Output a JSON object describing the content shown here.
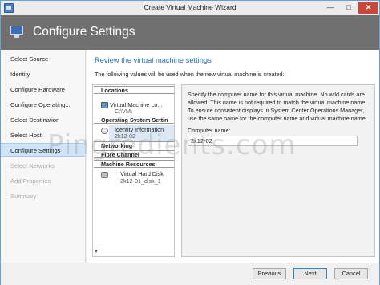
{
  "window": {
    "title": "Create Virtual Machine Wizard"
  },
  "banner": {
    "title": "Configure Settings",
    "icon": "monitor-icon"
  },
  "nav": {
    "items": [
      {
        "label": "Select Source",
        "state": "normal"
      },
      {
        "label": "Identity",
        "state": "normal"
      },
      {
        "label": "Configure Hardware",
        "state": "normal"
      },
      {
        "label": "Configure Operating...",
        "state": "normal"
      },
      {
        "label": "Select Destination",
        "state": "normal"
      },
      {
        "label": "Select Host",
        "state": "normal"
      },
      {
        "label": "Configure Settings",
        "state": "active"
      },
      {
        "label": "Select Networks",
        "state": "disabled"
      },
      {
        "label": "Add Properties",
        "state": "disabled"
      },
      {
        "label": "Summary",
        "state": "disabled"
      }
    ]
  },
  "content": {
    "heading": "Review the virtual machine settings",
    "intro": "The following values will be used when the new virtual machine is created:"
  },
  "tree": {
    "groups": {
      "locations": "Locations",
      "os_settings": "Operating System Settin",
      "networking": "Networking",
      "fibre_channel": "Fibre Channel",
      "machine_resources": "Machine Resources"
    },
    "items": {
      "vm_location": "Virtual Machine Lo...",
      "vm_location_sub": "C:\\VM\\",
      "identity": "Identity Information",
      "identity_sub": "2k12-02",
      "disk": "Virtual Hard Disk",
      "disk_sub": "2k12-01_disk_1"
    }
  },
  "detail": {
    "description": "Specify the computer name for this virtual machine. No wild cards are allowed. This name is not required to match the virtual machine name. To ensure consistent displays in System Center Operations Manager, use the same name for the computer name and virtual machine name.",
    "field_label": "Computer name:",
    "field_value": "2k12-02"
  },
  "footer": {
    "previous": "Previous",
    "next": "Next",
    "cancel": "Cancel"
  },
  "watermark": "Pingredients.com",
  "colors": {
    "banner": "#707070",
    "heading": "#2a6db5",
    "active_nav": "#cfe4f7",
    "close": "#c7473b"
  }
}
